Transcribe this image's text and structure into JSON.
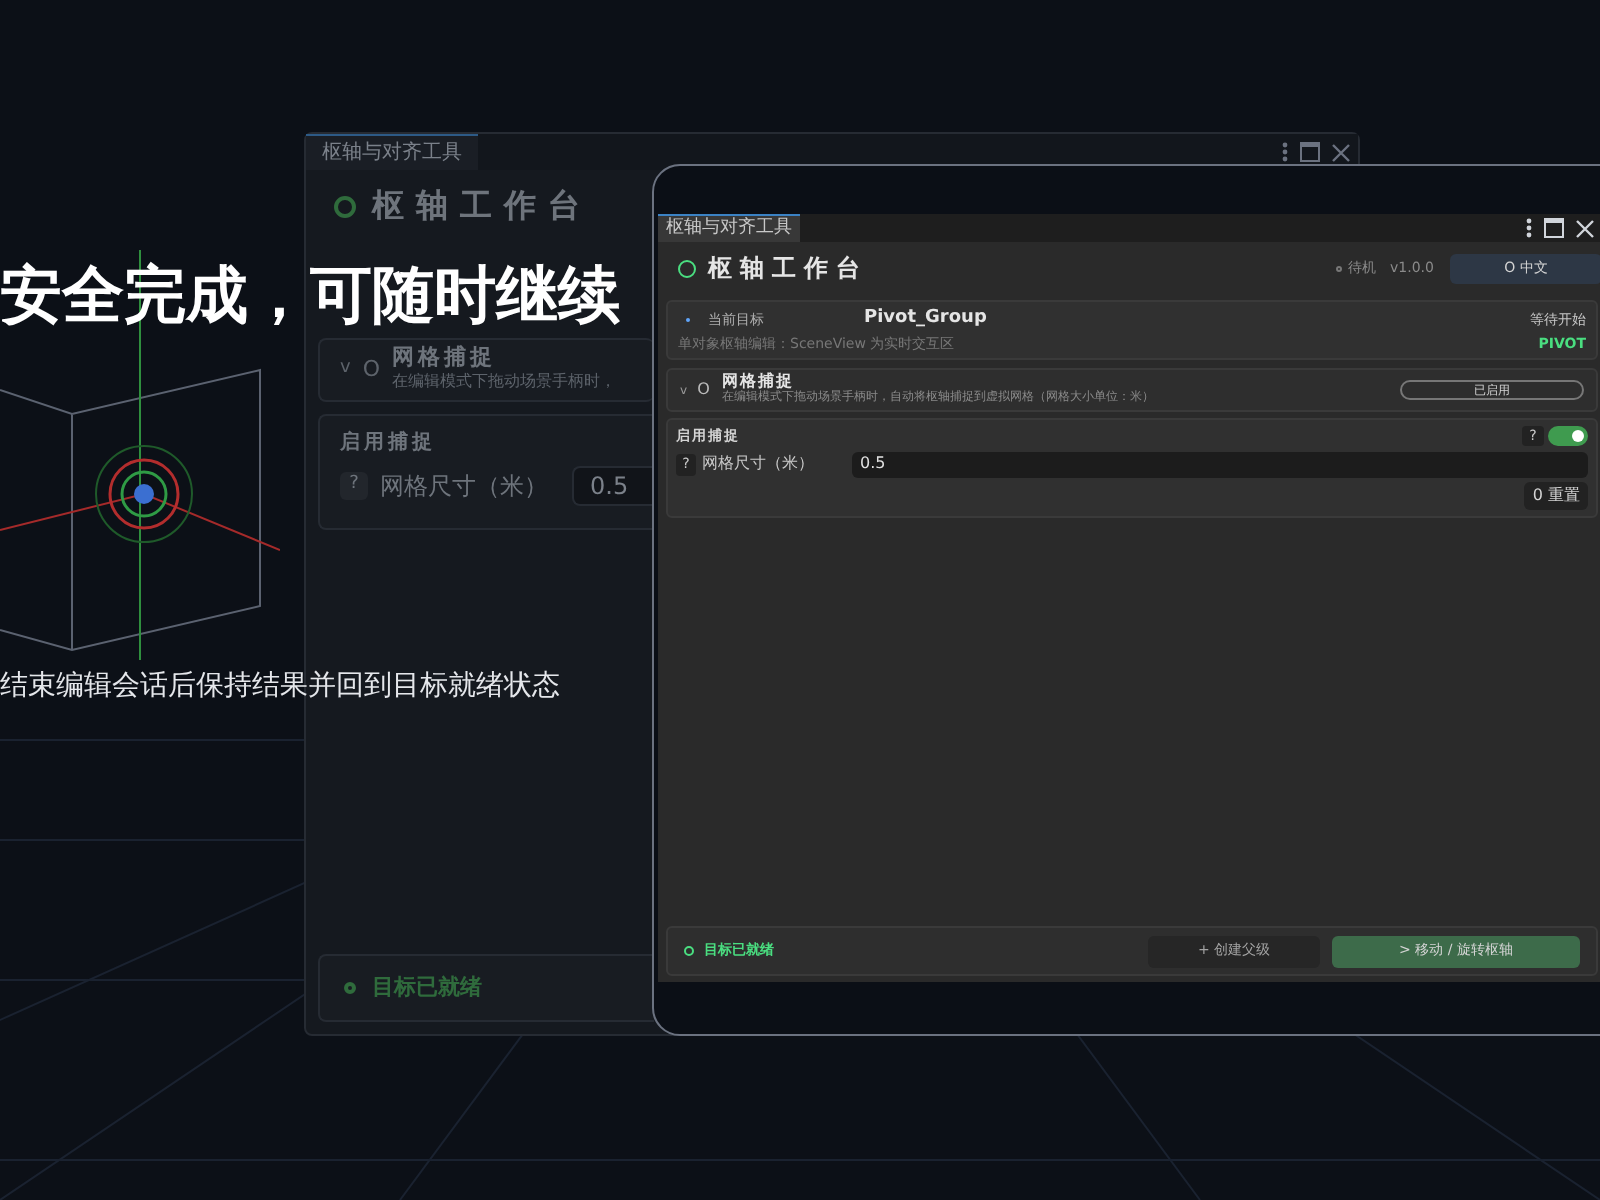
{
  "slide": {
    "headline": "安全完成，可随时继续",
    "subtitle": "结束编辑会话后保持结果并回到目标就绪状态"
  },
  "back_window": {
    "tab": "枢轴与对齐工具",
    "title": "枢轴工作台",
    "section": {
      "expand": "v",
      "icon": "O",
      "title": "网格捕捉",
      "description": "在编辑模式下拖动场景手柄时，"
    },
    "snap": {
      "label": "启用捕捉",
      "help": "?",
      "field_label": "网格尺寸（米）",
      "value": "0.5"
    },
    "status": "目标已就绪"
  },
  "window": {
    "tab": "枢轴与对齐工具",
    "title": "枢轴工作台",
    "state": "待机",
    "version": "v1.0.0",
    "language_button": "O 中文",
    "target": {
      "label": "当前目标",
      "name": "Pivot_Group",
      "status": "等待开始",
      "description": "单对象枢轴编辑：SceneView 为实时交互区",
      "mode": "PIVOT"
    },
    "section": {
      "expand": "v",
      "icon": "O",
      "title": "网格捕捉",
      "description": "在编辑模式下拖动场景手柄时，自动将枢轴捕捉到虚拟网格（网格大小单位：米）",
      "badge": "已启用"
    },
    "snap": {
      "label": "启用捕捉",
      "help": "?",
      "on": true,
      "field_help": "?",
      "field_label": "网格尺寸（米）",
      "value": "0.5",
      "reset": "0 重置"
    },
    "footer": {
      "status": "目标已就绪",
      "buttons": [
        {
          "label": "+ 创建父级",
          "kind": "secondary"
        },
        {
          "label": "> 移动 / 旋转枢轴",
          "kind": "primary"
        }
      ]
    }
  }
}
